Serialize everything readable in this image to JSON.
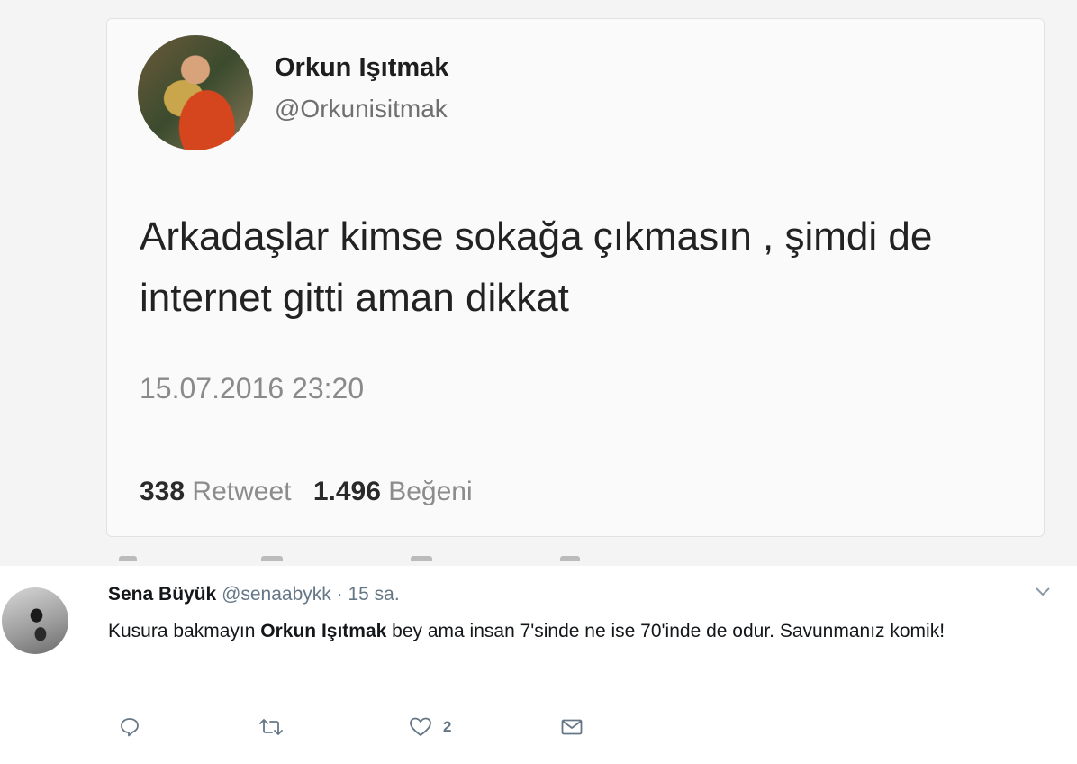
{
  "quoted_tweet": {
    "display_name": "Orkun Işıtmak",
    "handle": "@Orkunisitmak",
    "text": "Arkadaşlar kimse sokağa çıkmasın , şimdi de internet gitti aman dikkat",
    "datetime": "15.07.2016 23:20",
    "retweet_count": "338",
    "retweet_label": "Retweet",
    "like_count": "1.496",
    "like_label": "Beğeni"
  },
  "reply": {
    "display_name": "Sena Büyük",
    "handle": "@senaabykk",
    "separator": "·",
    "time": "15 sa.",
    "text_before": "Kusura bakmayın ",
    "mention": "Orkun Işıtmak",
    "text_after": " bey ama insan 7'sinde ne ise 70'inde de odur. Savunmanız komik!",
    "like_count": "2"
  },
  "icons": {
    "reply": "reply-icon",
    "retweet": "retweet-icon",
    "like": "heart-icon",
    "dm": "envelope-icon",
    "more": "chevron-down-icon"
  },
  "colors": {
    "icon_gray": "#657786",
    "text_dark": "#14171a"
  }
}
